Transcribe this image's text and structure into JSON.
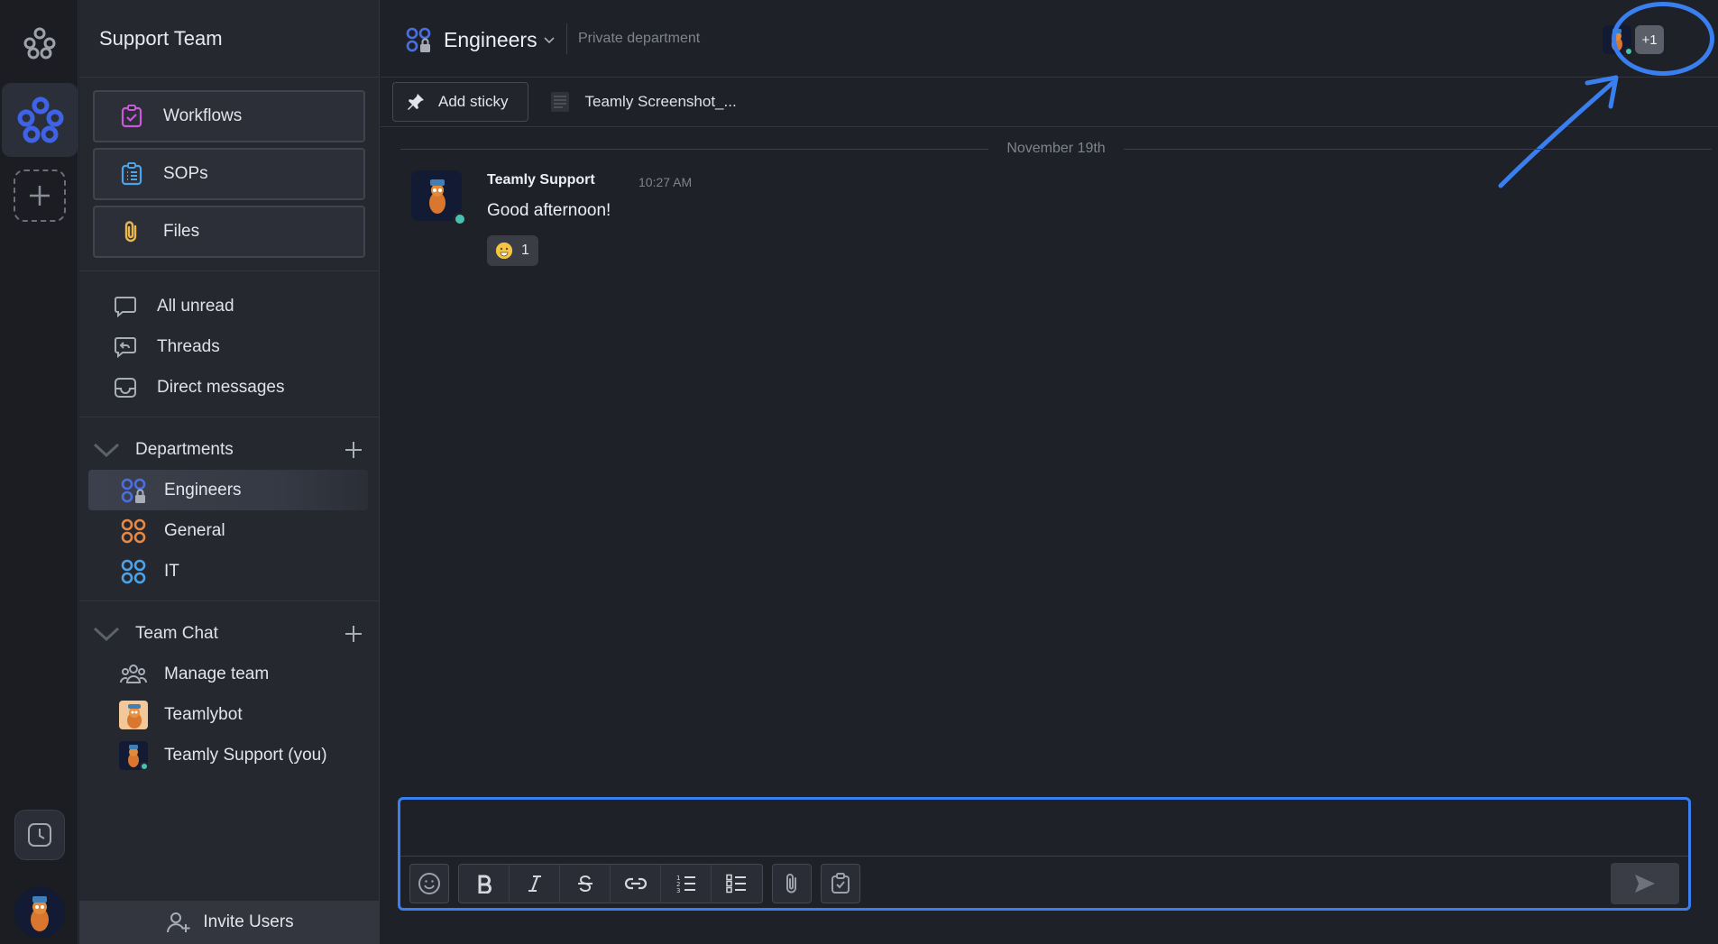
{
  "workspace": {
    "name": "Support Team"
  },
  "tiles": [
    {
      "label": "Workflows",
      "icon": "workflows-icon",
      "color": "#c85ad8"
    },
    {
      "label": "SOPs",
      "icon": "sops-icon",
      "color": "#4da3e8"
    },
    {
      "label": "Files",
      "icon": "paperclip-icon",
      "color": "#e8b84a"
    }
  ],
  "links": [
    {
      "label": "All unread",
      "icon": "chat-bubble-icon"
    },
    {
      "label": "Threads",
      "icon": "threads-icon"
    },
    {
      "label": "Direct messages",
      "icon": "inbox-icon"
    }
  ],
  "departments": {
    "title": "Departments",
    "items": [
      {
        "label": "Engineers",
        "icon": "department-private-icon",
        "color": "#4a6fe0",
        "active": true
      },
      {
        "label": "General",
        "icon": "department-icon",
        "color": "#e88845"
      },
      {
        "label": "IT",
        "icon": "department-icon",
        "color": "#4da3e8"
      }
    ]
  },
  "team_chat": {
    "title": "Team Chat",
    "items": [
      {
        "label": "Manage team",
        "icon": "team-icon"
      },
      {
        "label": "Teamlybot",
        "icon": "teamlybot-avatar"
      },
      {
        "label": "Teamly Support (you)",
        "icon": "support-avatar"
      }
    ]
  },
  "invite": {
    "label": "Invite Users"
  },
  "header": {
    "department": "Engineers",
    "department_type": "Private department",
    "members_more": "+1"
  },
  "stickybar": {
    "add_sticky": "Add sticky",
    "file": "Teamly Screenshot_..."
  },
  "feed": {
    "date": "November 19th",
    "messages": [
      {
        "author": "Teamly Support",
        "time": "10:27 AM",
        "text": "Good afternoon!",
        "reaction_count": "1"
      }
    ]
  },
  "colors": {
    "accent": "#3a7ff0",
    "online": "#47c2b1",
    "brand": "#4a6fe0"
  }
}
